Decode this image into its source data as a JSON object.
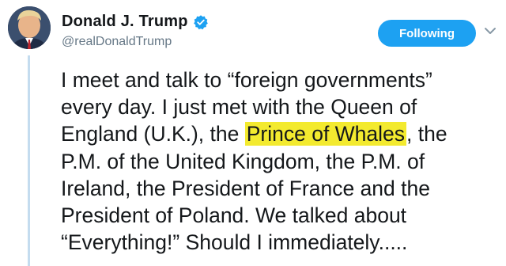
{
  "author": {
    "display_name": "Donald J. Trump",
    "handle": "@realDonaldTrump",
    "verified": true,
    "avatar_icon": "profile-photo-icon"
  },
  "actions": {
    "follow_label": "Following",
    "menu_icon": "chevron-down-icon"
  },
  "colors": {
    "accent": "#1da1f2",
    "highlight": "#f3ea2f",
    "text": "#14171a",
    "muted": "#657786",
    "thread_line": "#c4dcef"
  },
  "tweet": {
    "lines": [
      {
        "text": "I meet and talk to “foreign governments”"
      },
      {
        "text": "every day. I just met with the Queen of"
      },
      {
        "before": "England (U.K.), the ",
        "highlight": "Prince of Whales",
        "after": ", the"
      },
      {
        "text": "P.M. of the United Kingdom, the P.M. of"
      },
      {
        "text": "Ireland, the President of France and the"
      },
      {
        "text": "President of Poland. We talked about"
      },
      {
        "text": "“Everything!” Should I immediately....."
      }
    ]
  }
}
